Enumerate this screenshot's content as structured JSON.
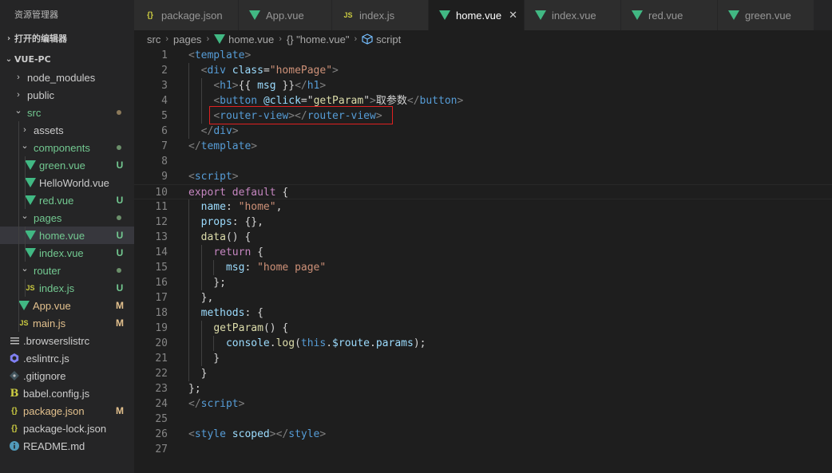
{
  "colors": {
    "background": "#1e1e1e",
    "sidebar": "#252526",
    "untracked": "#73c991",
    "modified": "#e2c08d",
    "vue_green": "#41b883",
    "js_yellow": "#cbcb41",
    "json_yellow": "#cbcb41",
    "highlight_box": "#e02020"
  },
  "sidebar": {
    "header": "资源管理器",
    "open_editors": "打开的编辑器",
    "project": "VUE-PC",
    "items": [
      {
        "label": "node_modules",
        "icon": "chevron-right-icon",
        "status": ""
      },
      {
        "label": "public",
        "icon": "chevron-right-icon",
        "status": ""
      },
      {
        "label": "src",
        "icon": "chevron-down-icon",
        "status": "dot"
      },
      {
        "label": "assets",
        "icon": "chevron-right-icon",
        "status": ""
      },
      {
        "label": "components",
        "icon": "chevron-down-icon",
        "status": "dot"
      },
      {
        "label": "green.vue",
        "icon": "vue-icon",
        "status": "U"
      },
      {
        "label": "HelloWorld.vue",
        "icon": "vue-icon",
        "status": ""
      },
      {
        "label": "red.vue",
        "icon": "vue-icon",
        "status": "U"
      },
      {
        "label": "pages",
        "icon": "chevron-down-icon",
        "status": "dot"
      },
      {
        "label": "home.vue",
        "icon": "vue-icon",
        "status": "U"
      },
      {
        "label": "index.vue",
        "icon": "vue-icon",
        "status": "U"
      },
      {
        "label": "router",
        "icon": "chevron-down-icon",
        "status": "dot"
      },
      {
        "label": "index.js",
        "icon": "js-icon",
        "status": "U"
      },
      {
        "label": "App.vue",
        "icon": "vue-icon",
        "status": "M"
      },
      {
        "label": "main.js",
        "icon": "js-icon",
        "status": "M"
      },
      {
        "label": ".browserslistrc",
        "icon": "lines-icon",
        "status": ""
      },
      {
        "label": ".eslintrc.js",
        "icon": "eslint-icon",
        "status": ""
      },
      {
        "label": ".gitignore",
        "icon": "git-icon",
        "status": ""
      },
      {
        "label": "babel.config.js",
        "icon": "babel-icon",
        "status": ""
      },
      {
        "label": "package.json",
        "icon": "json-icon",
        "status": "M"
      },
      {
        "label": "package-lock.json",
        "icon": "json-icon",
        "status": ""
      },
      {
        "label": "README.md",
        "icon": "info-icon",
        "status": ""
      }
    ]
  },
  "tabs": [
    {
      "label": "package.json",
      "icon": "json-icon"
    },
    {
      "label": "App.vue",
      "icon": "vue-icon"
    },
    {
      "label": "index.js",
      "icon": "js-icon"
    },
    {
      "label": "home.vue",
      "icon": "vue-icon",
      "close": "✕"
    },
    {
      "label": "index.vue",
      "icon": "vue-icon"
    },
    {
      "label": "red.vue",
      "icon": "vue-icon"
    },
    {
      "label": "green.vue",
      "icon": "vue-icon"
    }
  ],
  "breadcrumb": {
    "parts": [
      "src",
      "pages",
      "home.vue",
      "{} \"home.vue\"",
      "script"
    ]
  },
  "editor": {
    "lines": [
      {
        "n": "1",
        "tokens": [
          [
            "br",
            "<"
          ],
          [
            "tag",
            "template"
          ],
          [
            "br",
            ">"
          ]
        ]
      },
      {
        "n": "2",
        "tokens": [
          [
            "txt",
            "  "
          ],
          [
            "br",
            "<"
          ],
          [
            "tag",
            "div"
          ],
          [
            "txt",
            " "
          ],
          [
            "attr",
            "class"
          ],
          [
            "txt",
            "="
          ],
          [
            "str",
            "\"homePage\""
          ],
          [
            "br",
            ">"
          ]
        ]
      },
      {
        "n": "3",
        "tokens": [
          [
            "txt",
            "    "
          ],
          [
            "br",
            "<"
          ],
          [
            "tag",
            "h1"
          ],
          [
            "br",
            ">"
          ],
          [
            "txt",
            "{{ "
          ],
          [
            "var",
            "msg"
          ],
          [
            "txt",
            " }}"
          ],
          [
            "br",
            "</"
          ],
          [
            "tag",
            "h1"
          ],
          [
            "br",
            ">"
          ]
        ]
      },
      {
        "n": "4",
        "tokens": [
          [
            "txt",
            "    "
          ],
          [
            "br",
            "<"
          ],
          [
            "tag",
            "button"
          ],
          [
            "txt",
            " "
          ],
          [
            "attr",
            "@click"
          ],
          [
            "txt",
            "="
          ],
          [
            "txt",
            "\""
          ],
          [
            "fn",
            "getParam"
          ],
          [
            "txt",
            "\""
          ],
          [
            "br",
            ">"
          ],
          [
            "txt",
            "取参数"
          ],
          [
            "br",
            "</"
          ],
          [
            "tag",
            "button"
          ],
          [
            "br",
            ">"
          ]
        ]
      },
      {
        "n": "5",
        "tokens": [
          [
            "txt",
            "    "
          ],
          [
            "br",
            "<"
          ],
          [
            "tag",
            "router-view"
          ],
          [
            "br",
            "></"
          ],
          [
            "tag",
            "router-view"
          ],
          [
            "br",
            ">"
          ]
        ]
      },
      {
        "n": "6",
        "tokens": [
          [
            "txt",
            "  "
          ],
          [
            "br",
            "</"
          ],
          [
            "tag",
            "div"
          ],
          [
            "br",
            ">"
          ]
        ]
      },
      {
        "n": "7",
        "tokens": [
          [
            "br",
            "</"
          ],
          [
            "tag",
            "template"
          ],
          [
            "br",
            ">"
          ]
        ]
      },
      {
        "n": "8",
        "tokens": []
      },
      {
        "n": "9",
        "tokens": [
          [
            "br",
            "<"
          ],
          [
            "tag",
            "script"
          ],
          [
            "br",
            ">"
          ]
        ]
      },
      {
        "n": "10",
        "tokens": [
          [
            "kw",
            "export"
          ],
          [
            "txt",
            " "
          ],
          [
            "kw",
            "default"
          ],
          [
            "txt",
            " {"
          ]
        ]
      },
      {
        "n": "11",
        "tokens": [
          [
            "txt",
            "  "
          ],
          [
            "prop",
            "name"
          ],
          [
            "txt",
            ": "
          ],
          [
            "str",
            "\"home\""
          ],
          [
            "txt",
            ","
          ]
        ]
      },
      {
        "n": "12",
        "tokens": [
          [
            "txt",
            "  "
          ],
          [
            "prop",
            "props"
          ],
          [
            "txt",
            ": {},"
          ]
        ]
      },
      {
        "n": "13",
        "tokens": [
          [
            "txt",
            "  "
          ],
          [
            "fn",
            "data"
          ],
          [
            "txt",
            "() {"
          ]
        ]
      },
      {
        "n": "14",
        "tokens": [
          [
            "txt",
            "    "
          ],
          [
            "kw",
            "return"
          ],
          [
            "txt",
            " {"
          ]
        ]
      },
      {
        "n": "15",
        "tokens": [
          [
            "txt",
            "      "
          ],
          [
            "prop",
            "msg"
          ],
          [
            "txt",
            ": "
          ],
          [
            "str",
            "\"home page\""
          ]
        ]
      },
      {
        "n": "16",
        "tokens": [
          [
            "txt",
            "    };"
          ]
        ]
      },
      {
        "n": "17",
        "tokens": [
          [
            "txt",
            "  },"
          ]
        ]
      },
      {
        "n": "18",
        "tokens": [
          [
            "txt",
            "  "
          ],
          [
            "prop",
            "methods"
          ],
          [
            "txt",
            ": {"
          ]
        ]
      },
      {
        "n": "19",
        "tokens": [
          [
            "txt",
            "    "
          ],
          [
            "fn",
            "getParam"
          ],
          [
            "txt",
            "() {"
          ]
        ]
      },
      {
        "n": "20",
        "tokens": [
          [
            "txt",
            "      "
          ],
          [
            "var",
            "console"
          ],
          [
            "txt",
            "."
          ],
          [
            "fn",
            "log"
          ],
          [
            "txt",
            "("
          ],
          [
            "kwb",
            "this"
          ],
          [
            "txt",
            "."
          ],
          [
            "var",
            "$route"
          ],
          [
            "txt",
            "."
          ],
          [
            "var",
            "params"
          ],
          [
            "txt",
            ");"
          ]
        ]
      },
      {
        "n": "21",
        "tokens": [
          [
            "txt",
            "    }"
          ]
        ]
      },
      {
        "n": "22",
        "tokens": [
          [
            "txt",
            "  }"
          ]
        ]
      },
      {
        "n": "23",
        "tokens": [
          [
            "txt",
            "};"
          ]
        ]
      },
      {
        "n": "24",
        "tokens": [
          [
            "br",
            "</"
          ],
          [
            "tag",
            "script"
          ],
          [
            "br",
            ">"
          ]
        ]
      },
      {
        "n": "25",
        "tokens": []
      },
      {
        "n": "26",
        "tokens": [
          [
            "br",
            "<"
          ],
          [
            "tag",
            "style"
          ],
          [
            "txt",
            " "
          ],
          [
            "attr",
            "scoped"
          ],
          [
            "br",
            "></"
          ],
          [
            "tag",
            "style"
          ],
          [
            "br",
            ">"
          ]
        ]
      },
      {
        "n": "27",
        "tokens": []
      }
    ]
  }
}
